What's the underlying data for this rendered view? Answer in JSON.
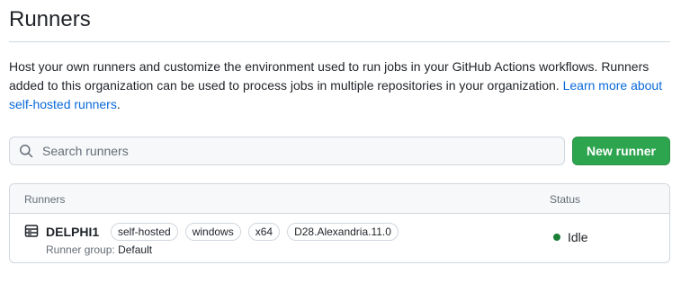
{
  "page": {
    "title": "Runners",
    "description_text": "Host your own runners and customize the environment used to run jobs in your GitHub Actions workflows. Runners added to this organization can be used to process jobs in multiple repositories in your organization. ",
    "learn_more_link": "Learn more about self-hosted runners",
    "description_end": "."
  },
  "search": {
    "placeholder": "Search runners",
    "value": "",
    "icon": "search-icon"
  },
  "actions": {
    "new_runner_label": "New runner"
  },
  "table": {
    "header_runners": "Runners",
    "header_status": "Status",
    "rows": [
      {
        "icon": "server-icon",
        "name": "DELPHI1",
        "labels": [
          "self-hosted",
          "windows",
          "x64",
          "D28.Alexandria.11.0"
        ],
        "group_label": "Runner group:",
        "group_value": "Default",
        "status": "Idle",
        "status_color": "#1a7f37"
      }
    ]
  },
  "colors": {
    "accent_link": "#0969da",
    "primary_button": "#2da44e",
    "border": "#d0d7de"
  }
}
